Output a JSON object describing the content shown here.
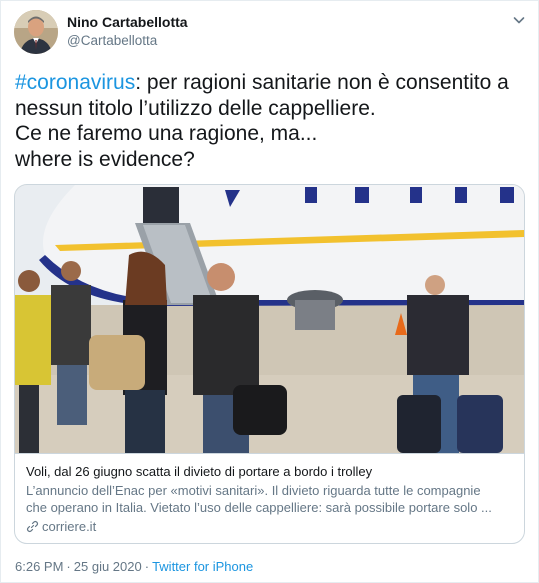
{
  "author": {
    "name": "Nino Cartabellotta",
    "handle": "@Cartabellotta",
    "avatar_icon": "profile-photo"
  },
  "menu_icon": "chevron-down-icon",
  "tweet": {
    "hashtag": "#coronavirus",
    "line1_rest": ": per ragioni sanitarie non è consentito a",
    "line2": "nessun titolo l’utilizzo delle cappelliere.",
    "line3": "Ce ne faremo una ragione, ma...",
    "line4": "where is evidence?"
  },
  "card": {
    "image_description_icon": "airport-boarding-photo",
    "title": "Voli, dal 26 giugno scatta il divieto di portare a bordo i trolley",
    "description_line1": "L’annuncio dell’Enac per «motivi sanitari». Il divieto riguarda tutte le compagnie",
    "description_line2": "che operano in Italia. Vietato l’uso delle cappelliere: sarà possibile portare solo ...",
    "domain": "corriere.it"
  },
  "meta": {
    "time": "6:26 PM",
    "separator": "·",
    "date": "25 giu 2020",
    "source": "Twitter for iPhone"
  },
  "colors": {
    "link": "#1b95e0",
    "secondary_text": "#657786",
    "border": "#ccd6dd"
  }
}
